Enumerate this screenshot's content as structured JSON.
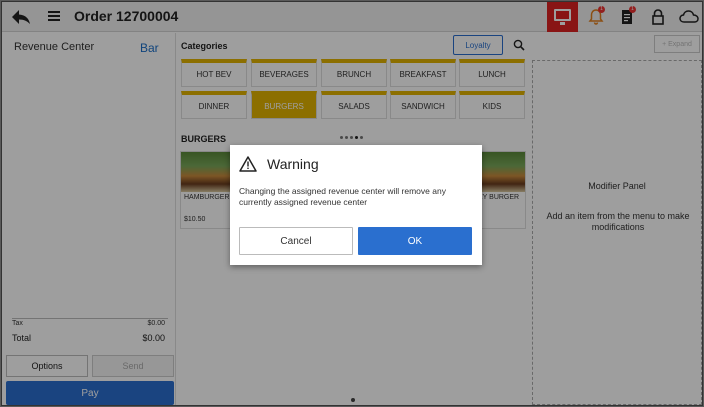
{
  "header": {
    "title": "Order 12700004",
    "notification_badge": "1",
    "orders_badge": "1"
  },
  "left_panel": {
    "revenue_center_label": "Revenue Center",
    "revenue_center_value": "Bar",
    "tax_label": "Tax",
    "tax_value": "$0.00",
    "total_label": "Total",
    "total_value": "$0.00",
    "options_label": "Options",
    "send_label": "Send",
    "pay_label": "Pay"
  },
  "menu": {
    "categories_heading": "Categories",
    "loyalty_label": "Loyalty",
    "categories": [
      "HOT BEV",
      "BEVERAGES",
      "BRUNCH",
      "BREAKFAST",
      "LUNCH",
      "DINNER",
      "BURGERS",
      "SALADS",
      "SANDWICH",
      "KIDS"
    ],
    "selected_category": "BURGERS",
    "section_heading": "BURGERS",
    "items": [
      {
        "name": "HAMBURGER",
        "price": "$10.50"
      },
      {
        "name": "EY BURGER",
        "price": ""
      }
    ]
  },
  "modifier_panel": {
    "expand_label": "+ Expand",
    "title": "Modifier Panel",
    "hint": "Add an item from the menu to make modifications"
  },
  "dialog": {
    "title": "Warning",
    "message": "Changing the assigned revenue center will remove any currently assigned revenue center",
    "cancel_label": "Cancel",
    "ok_label": "OK"
  },
  "colors": {
    "accent_blue": "#2a6fcf",
    "category_yellow": "#e2b400",
    "monitor_red": "#dd2222"
  }
}
